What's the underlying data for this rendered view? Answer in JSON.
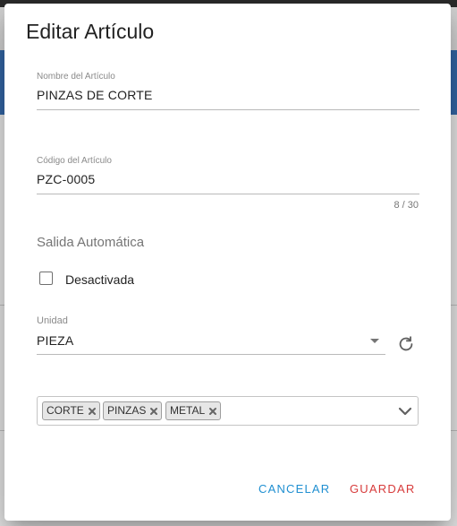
{
  "dialog": {
    "title": "Editar Artículo",
    "item_name": {
      "label": "Nombre del Artículo",
      "value": "PINZAS DE CORTE"
    },
    "item_code": {
      "label": "Código del Artículo",
      "value": "PZC-0005",
      "counter": "8 / 30"
    },
    "auto_exit": {
      "section_title": "Salida Automática",
      "checkbox_label": "Desactivada",
      "checked": false
    },
    "unit": {
      "label": "Unidad",
      "value": "PIEZA"
    },
    "tags": [
      "CORTE",
      "PINZAS",
      "METAL"
    ],
    "buttons": {
      "cancel": "CANCELAR",
      "save": "GUARDAR"
    }
  },
  "colors": {
    "cancel": "#1f8fd1",
    "save": "#d73b3b",
    "background_header": "#3467a6"
  }
}
